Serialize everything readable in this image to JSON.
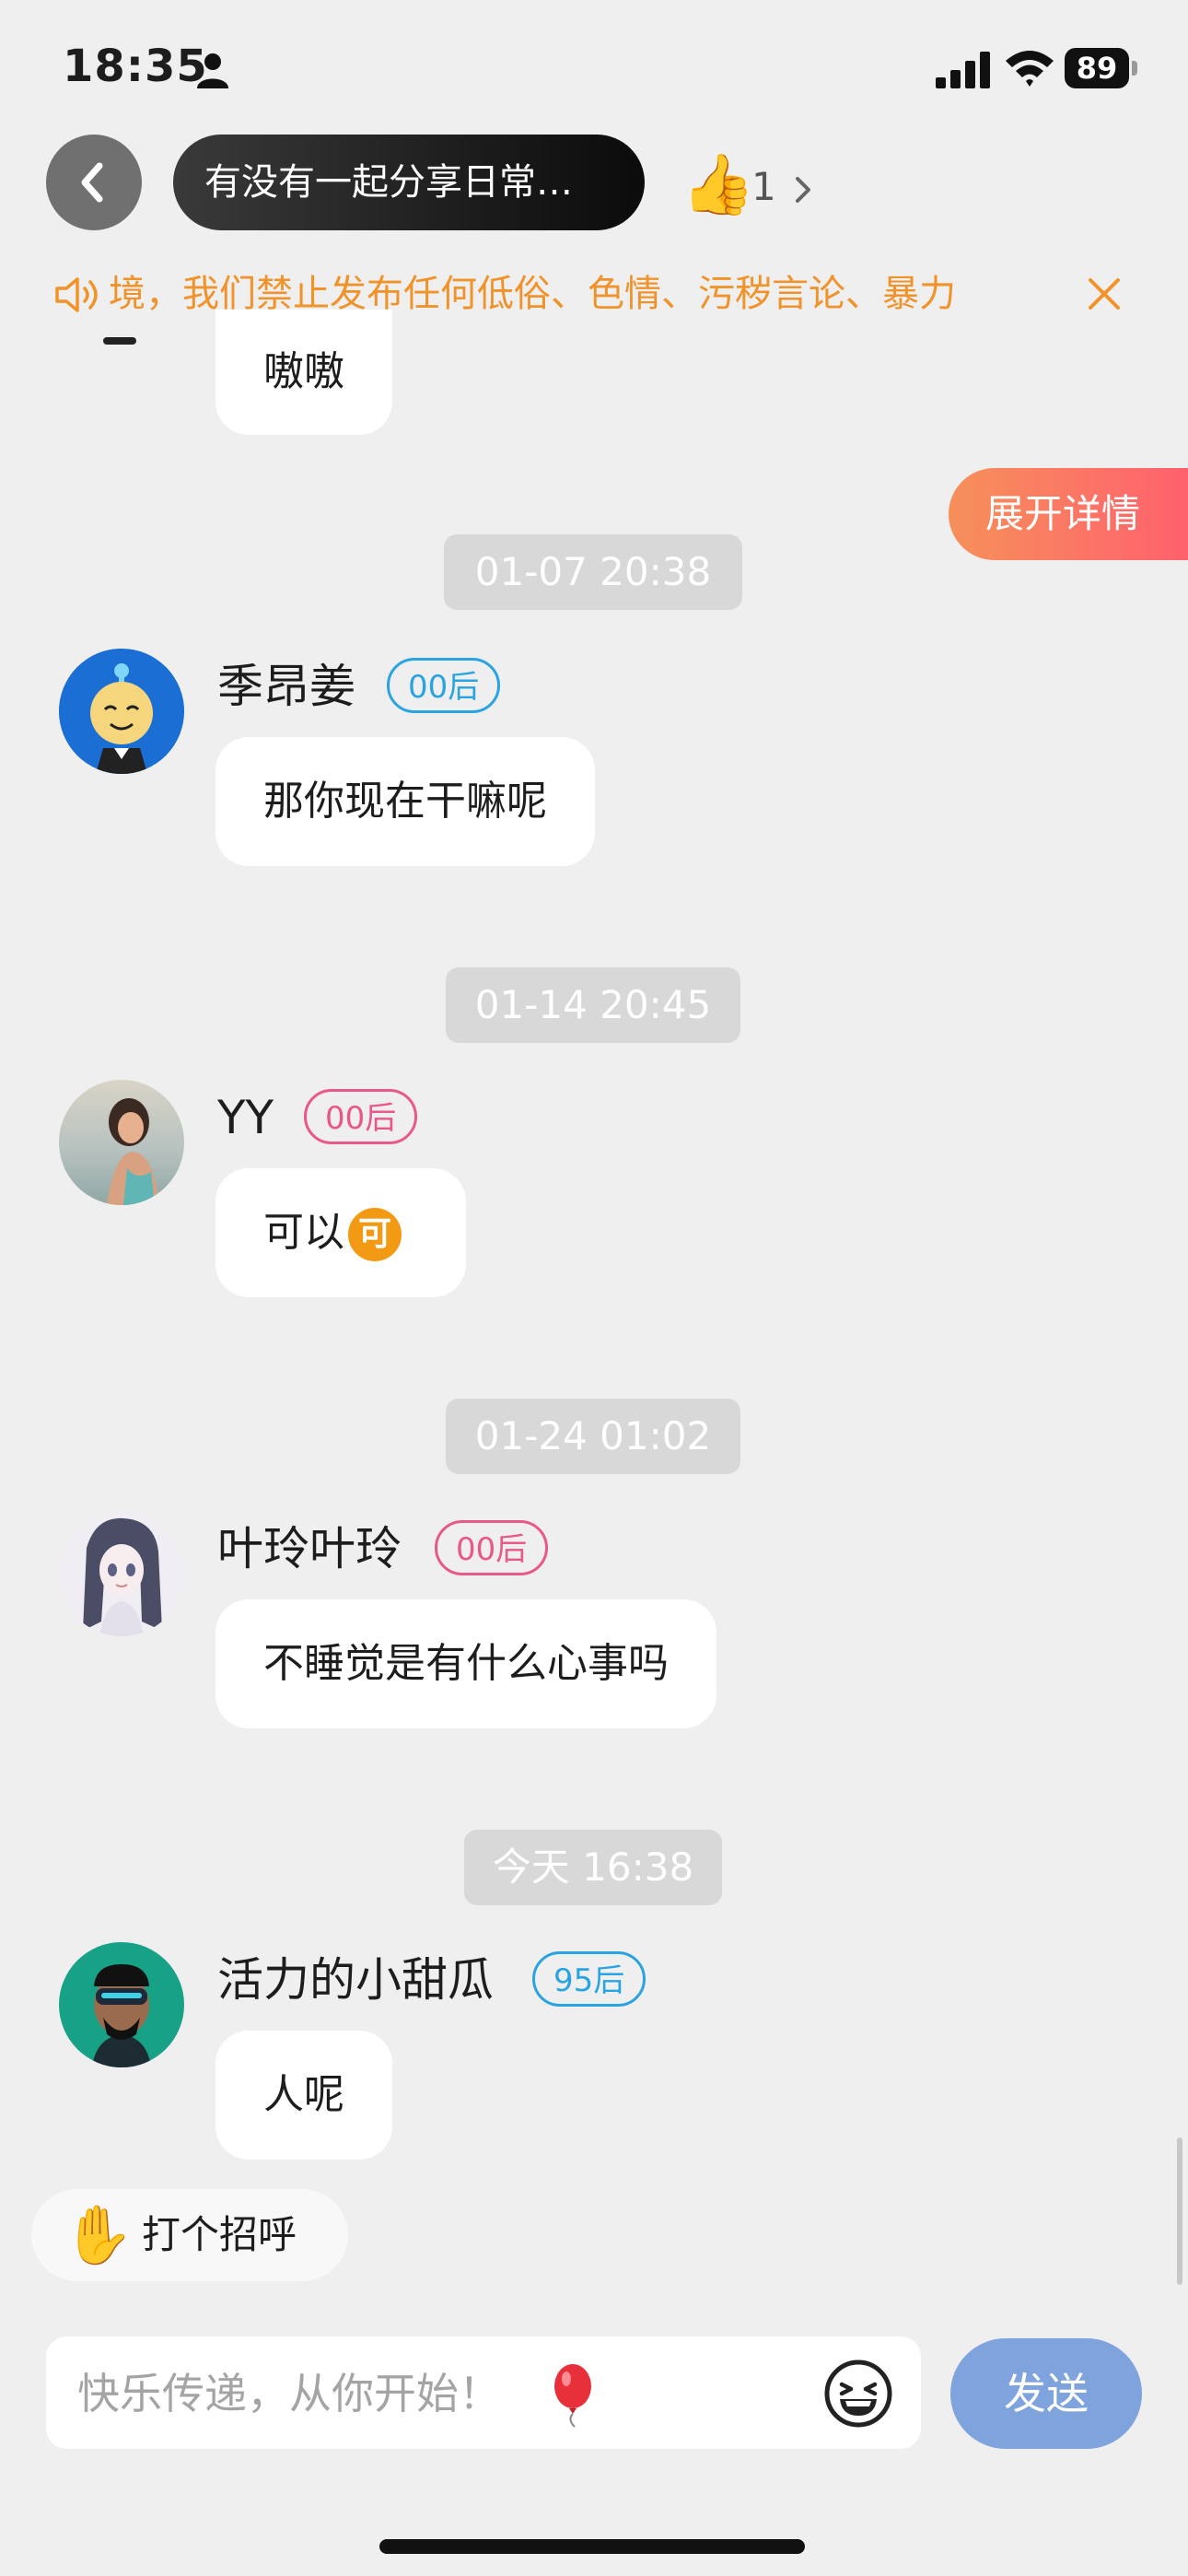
{
  "status_bar": {
    "time": "18:35",
    "battery": "89"
  },
  "header": {
    "topic": "有没有一起分享日常…",
    "like_icon": "thumbs-up",
    "like_count": "1"
  },
  "notice": {
    "text": "境，我们禁止发布任何低俗、色情、污秽言论、暴力"
  },
  "expand_details": "展开详情",
  "messages": [
    {
      "type": "partial",
      "text": "嗷嗷"
    },
    {
      "type": "timestamp",
      "text": "01-07 20:38"
    },
    {
      "type": "message",
      "name": "季昂姜",
      "tag": "00后",
      "tag_color": "blue",
      "text": "那你现在干嘛呢"
    },
    {
      "type": "timestamp",
      "text": "01-14 20:45"
    },
    {
      "type": "message",
      "name": "YY",
      "tag": "00后",
      "tag_color": "pink",
      "text": "可以",
      "emoji": "可"
    },
    {
      "type": "timestamp",
      "text": "01-24 01:02"
    },
    {
      "type": "message",
      "name": "叶玲叶玲",
      "tag": "00后",
      "tag_color": "pink",
      "text": "不睡觉是有什么心事吗"
    },
    {
      "type": "timestamp",
      "text": "今天 16:38"
    },
    {
      "type": "message",
      "name": "活力的小甜瓜",
      "tag": "95后",
      "tag_color": "blue",
      "text": "人呢"
    }
  ],
  "greet": {
    "icon": "waving-hand",
    "label": "打个招呼"
  },
  "composer": {
    "placeholder": "快乐传递，从你开始！",
    "send_label": "发送"
  },
  "colors": {
    "notice": "#f0932b",
    "send_button": "#7ea3dd",
    "tag_blue": "#2aa4e0",
    "tag_pink": "#e8588a"
  }
}
